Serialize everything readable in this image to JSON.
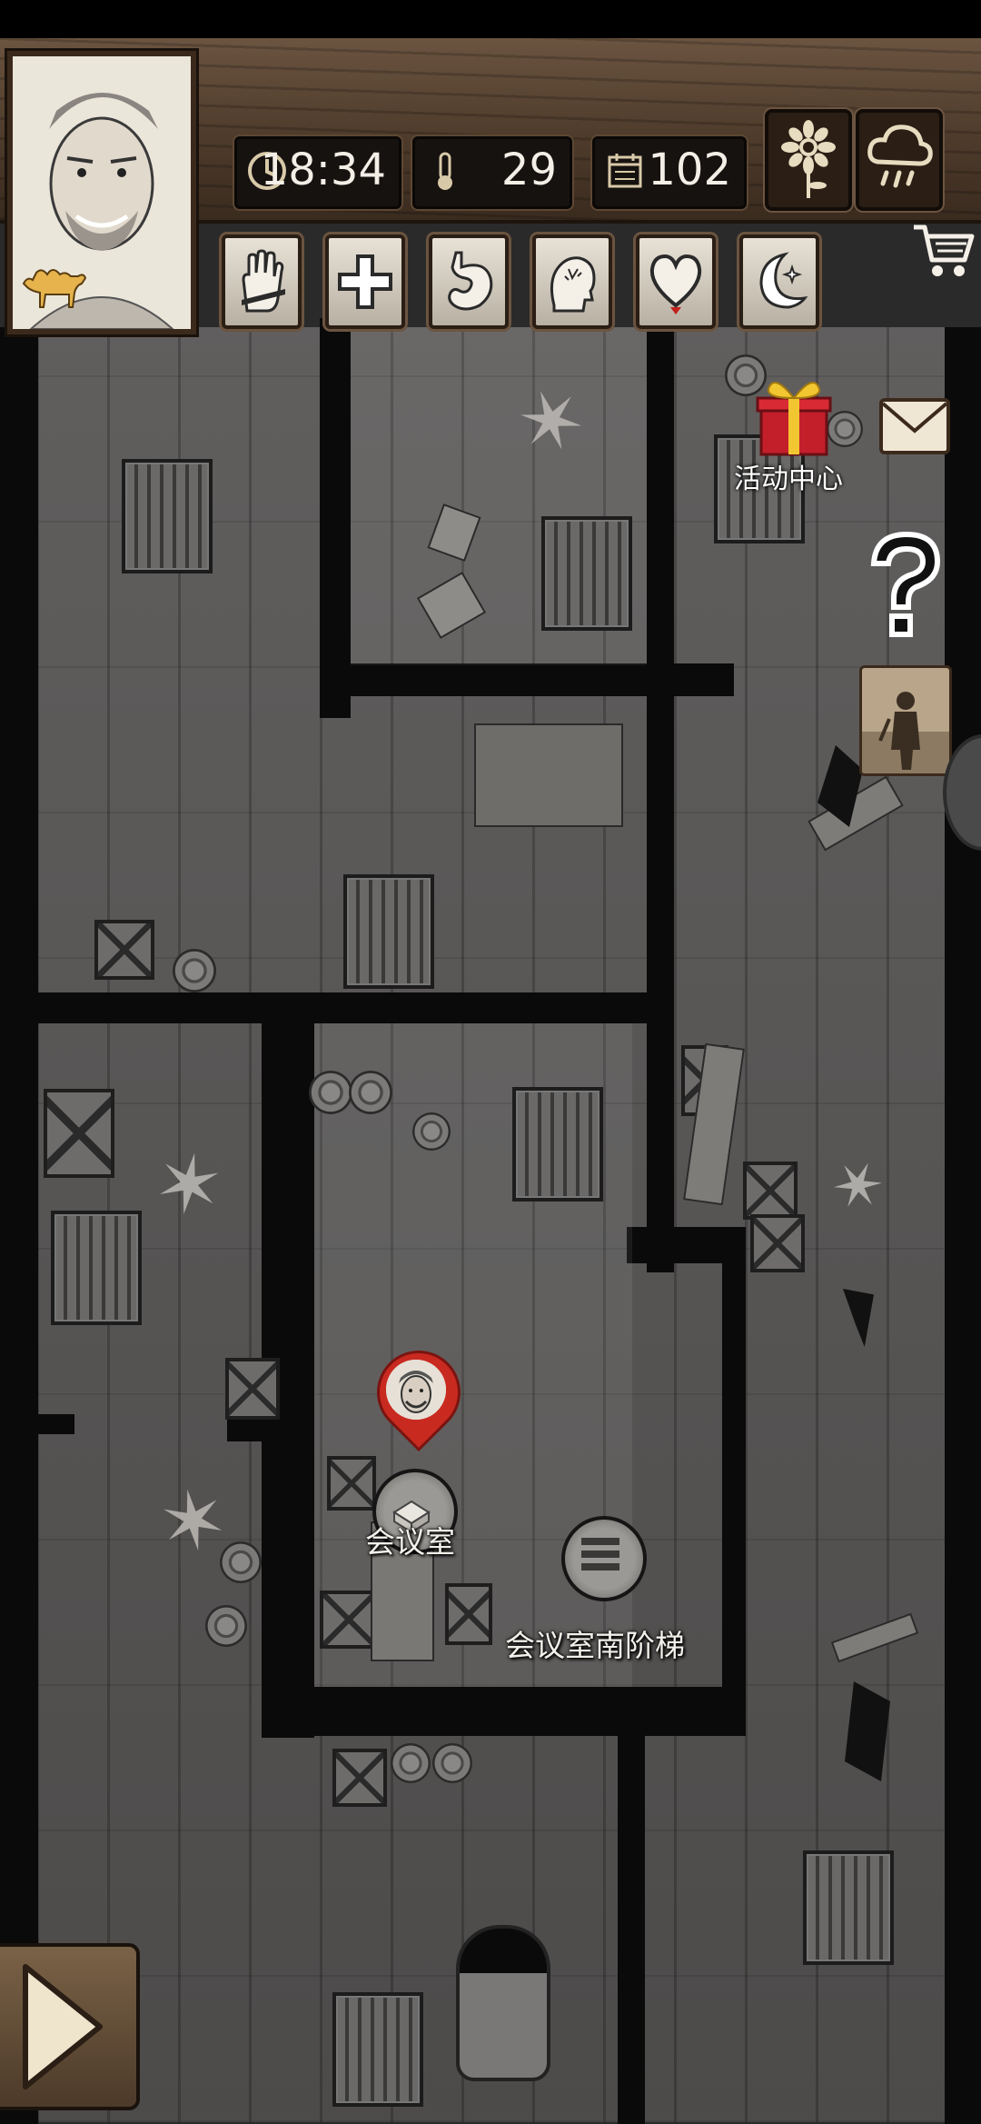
{
  "hud": {
    "time": "18:34",
    "temperature": "29",
    "day": "102",
    "icons": {
      "time": "clock-icon",
      "temperature": "thermometer-icon",
      "day": "calendar-icon",
      "weather_left": "sunflower-icon",
      "weather_right": "rain-cloud-icon",
      "shop": "shopping-cart-icon"
    },
    "skills": [
      "hand-icon",
      "medical-cross-icon",
      "stomach-icon",
      "head-icon",
      "heart-icon",
      "moon-icon"
    ]
  },
  "side": {
    "gift_label": "活动中心",
    "gift_icon": "gift-box-icon",
    "mail_icon": "envelope-icon",
    "help_icon": "question-mark-icon",
    "portrait_icon": "soldier-portrait-icon"
  },
  "map": {
    "current_location": "会议室",
    "locations": [
      {
        "name": "会议室",
        "icon": "room-icon"
      },
      {
        "name": "会议室南阶梯",
        "icon": "stairs-icon"
      }
    ]
  },
  "colors": {
    "wood": "#5a4432",
    "floor": "#5a5857",
    "wall": "#0a0a0a",
    "pin": "#c92a20",
    "skill_heart_indicator": "#c0201a"
  },
  "nav": {
    "next_icon": "arrow-right-icon"
  }
}
